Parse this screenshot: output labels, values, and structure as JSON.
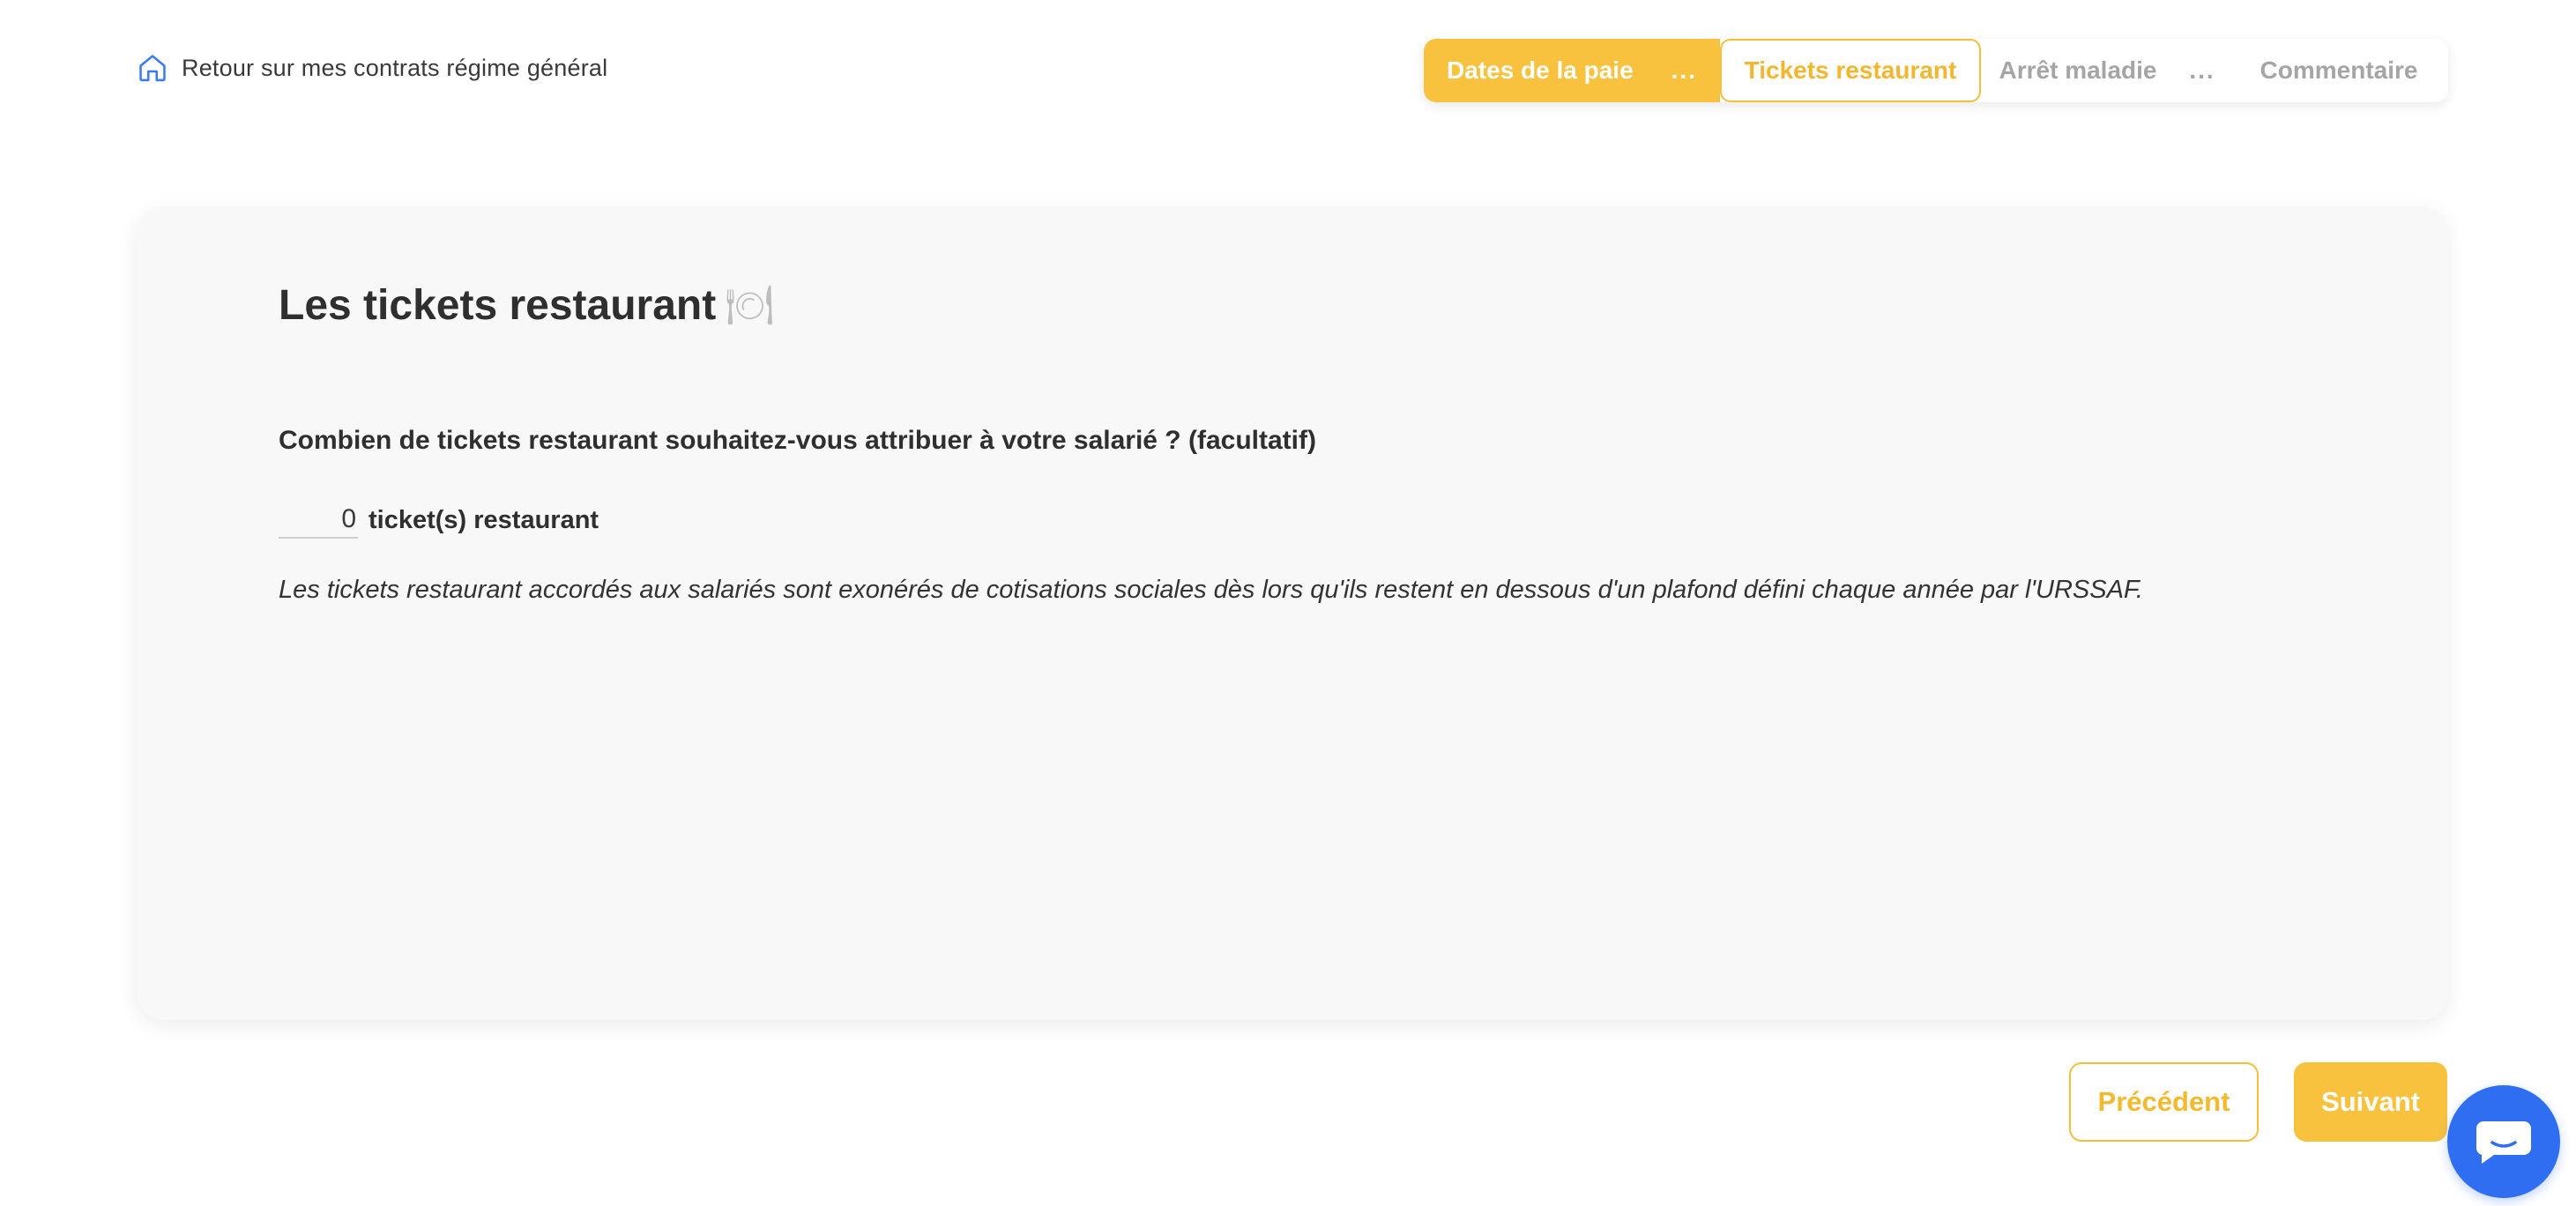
{
  "header": {
    "back_label": "Retour sur mes contrats régime général"
  },
  "stepper": {
    "done_label": "Dates de la paie",
    "done_ellipsis": "...",
    "active_label": "Tickets restaurant",
    "next_label": "Arrêt maladie",
    "next_ellipsis": "...",
    "last_label": "Commentaire"
  },
  "card": {
    "title": "Les tickets restaurant",
    "title_emoji": "🍽",
    "question": "Combien de tickets restaurant souhaitez-vous attribuer à votre salarié ? (facultatif)",
    "quantity_value": "0",
    "quantity_unit": "ticket(s) restaurant",
    "note": "Les tickets restaurant accordés aux salariés sont exonérés de cotisations sociales dès lors qu'ils restent en dessous d'un plafond défini chaque année par l'URSSAF."
  },
  "nav": {
    "prev_label": "Précédent",
    "next_label": "Suivant"
  },
  "colors": {
    "accent_yellow": "#f8c23f",
    "inactive_gray": "#a5a5a5",
    "home_icon_blue": "#3b7bf0",
    "chat_blue": "#2f6ef0"
  },
  "icons": {
    "back": "home-icon",
    "title": "plate-cutlery-icon",
    "chat": "chat-bubble-icon"
  }
}
